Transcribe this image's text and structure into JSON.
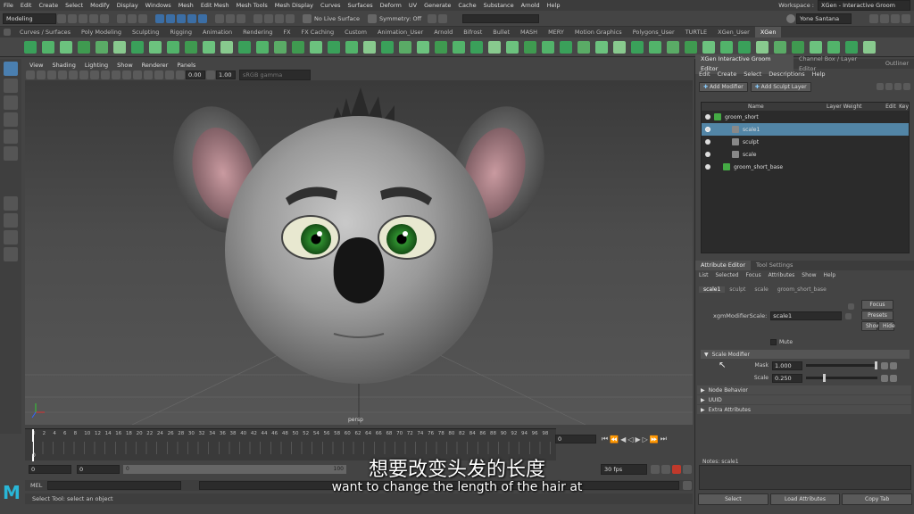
{
  "menubar": {
    "items": [
      "File",
      "Edit",
      "Create",
      "Select",
      "Modify",
      "Display",
      "Windows",
      "Mesh",
      "Edit Mesh",
      "Mesh Tools",
      "Mesh Display",
      "Curves",
      "Surfaces",
      "Deform",
      "UV",
      "Generate",
      "Cache",
      "Substance",
      "Arnold",
      "Help"
    ],
    "workspace_label": "Workspace :",
    "workspace_value": "XGen - Interactive Groom"
  },
  "statusline": {
    "mode": "Modeling",
    "live_surface": "No Live Surface",
    "symmetry": "Symmetry: Off",
    "user": "Yone Santana"
  },
  "shelf": {
    "tabs": [
      "Curves / Surfaces",
      "Poly Modeling",
      "Sculpting",
      "Rigging",
      "Animation",
      "Rendering",
      "FX",
      "FX Caching",
      "Custom",
      "Animation_User",
      "Arnold",
      "Bifrost",
      "Bullet",
      "MASH",
      "MERY",
      "Motion Graphics",
      "Polygons_User",
      "TURTLE",
      "XGen_User",
      "XGen"
    ],
    "active": "XGen",
    "icon_colors": [
      "#3aa05a",
      "#52b36a",
      "#6cc27e",
      "#3f9a50",
      "#5aab66",
      "#88c98e",
      "#3aa05a",
      "#6cc27e",
      "#52b36a",
      "#3f9a50",
      "#6cc27e",
      "#88c98e",
      "#3aa05a",
      "#52b36a",
      "#5aab66",
      "#3f9a50",
      "#6cc27e",
      "#3aa05a",
      "#52b36a",
      "#88c98e",
      "#3aa05a",
      "#5aab66",
      "#6cc27e",
      "#3f9a50",
      "#52b36a",
      "#3aa05a",
      "#88c98e",
      "#6cc27e",
      "#3f9a50",
      "#52b36a",
      "#3aa05a",
      "#5aab66",
      "#6cc27e",
      "#88c98e",
      "#3aa05a",
      "#52b36a",
      "#5aab66",
      "#3f9a50",
      "#6cc27e",
      "#52b36a",
      "#3aa05a",
      "#88c98e",
      "#5aab66",
      "#3f9a50",
      "#6cc27e",
      "#52b36a",
      "#3aa05a",
      "#88c98e"
    ]
  },
  "viewport": {
    "menu": [
      "View",
      "Shading",
      "Lighting",
      "Show",
      "Renderer",
      "Panels"
    ],
    "field1": "0.00",
    "field2": "1.00",
    "color_space": "sRGB gamma",
    "camera_label": "persp"
  },
  "timeline": {
    "ticks": [
      "0",
      "2",
      "4",
      "6",
      "8",
      "10",
      "12",
      "14",
      "16",
      "18",
      "20",
      "22",
      "24",
      "26",
      "28",
      "30",
      "32",
      "34",
      "36",
      "38",
      "40",
      "42",
      "44",
      "46",
      "48",
      "50",
      "52",
      "54",
      "56",
      "58",
      "60",
      "62",
      "64",
      "66",
      "68",
      "70",
      "72",
      "74",
      "76",
      "78",
      "80",
      "82",
      "84",
      "86",
      "88",
      "90",
      "92",
      "94",
      "96",
      "98"
    ],
    "current_frame": "0",
    "start_field": "0",
    "start_inner": "0",
    "end_inner": "100",
    "range_left": "0",
    "range_fps": "30 fps"
  },
  "mel": {
    "label": "MEL"
  },
  "helpline": {
    "text": "Select Tool: select an object"
  },
  "right_panel": {
    "tabs": [
      "XGen Interactive Groom Editor",
      "Channel Box / Layer Editor",
      "Outliner"
    ],
    "menu": [
      "Edit",
      "Create",
      "Select",
      "Descriptions",
      "Help"
    ],
    "add_modifier": "Add Modifier",
    "add_sculpt_layer": "Add Sculpt Layer",
    "columns": {
      "name": "Name",
      "weight": "Layer Weight",
      "edit": "Edit",
      "key": "Key"
    },
    "rows": [
      {
        "label": "groom_short"
      },
      {
        "label": "scale1"
      },
      {
        "label": "sculpt"
      },
      {
        "label": "scale"
      },
      {
        "label": "groom_short_base"
      }
    ],
    "attr_tabs": [
      "Attribute Editor",
      "Tool Settings"
    ],
    "attr_menu": [
      "List",
      "Selected",
      "Focus",
      "Attributes",
      "Show",
      "Help"
    ],
    "node_tabs": [
      "scale1",
      "sculpt",
      "scale",
      "groom_short_base"
    ],
    "node_type_label": "xgmModifierScale:",
    "node_name": "scale1",
    "focus": "Focus",
    "presets": "Presets",
    "show": "Show",
    "hide": "Hide",
    "mute": "Mute",
    "scale_modifier": "Scale Modifier",
    "mask_label": "Mask",
    "mask_value": "1.000",
    "mask_level": 1.0,
    "scale_label": "Scale",
    "scale_value": "0.250",
    "scale_level": 0.25,
    "sections": [
      "Node Behavior",
      "UUID",
      "Extra Attributes"
    ],
    "notes": "Notes:  scale1",
    "bottom_buttons": [
      "Select",
      "Load Attributes",
      "Copy Tab"
    ]
  },
  "subtitle": {
    "zh": "想要改变头发的长度",
    "en": "want to change the length of the hair at"
  },
  "colors": {
    "selection": "#5285a6",
    "accent_blue": "#4a90d9",
    "key_red": "#c0392b",
    "logo": "#29b6d6"
  }
}
